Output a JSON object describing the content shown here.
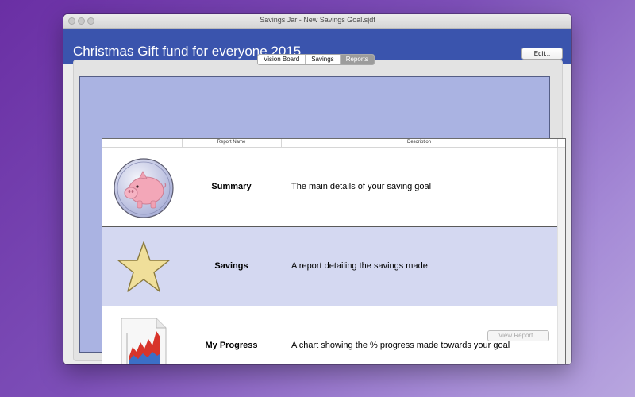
{
  "window": {
    "title": "Savings Jar - New Savings Goal.sjdf"
  },
  "header": {
    "goal_title": "Christmas Gift fund for everyone 2015",
    "edit_label": "Edit..."
  },
  "tabs": [
    {
      "label": "Vision Board"
    },
    {
      "label": "Savings"
    },
    {
      "label": "Reports",
      "selected": true
    }
  ],
  "table": {
    "columns": [
      "Report Name",
      "Description"
    ],
    "rows": [
      {
        "icon": "piggy-bank-icon",
        "name": "Summary",
        "description": "The main details of your saving goal"
      },
      {
        "icon": "star-icon",
        "name": "Savings",
        "description": "A report detailing the savings made"
      },
      {
        "icon": "chart-document-icon",
        "name": "My Progress",
        "description": "A chart showing the % progress made towards your goal"
      }
    ]
  },
  "footer": {
    "view_report_label": "View Report..."
  },
  "colors": {
    "header": "#3a54ad",
    "selected_row": "#d4d8f1",
    "frame": "#aab3e2"
  }
}
